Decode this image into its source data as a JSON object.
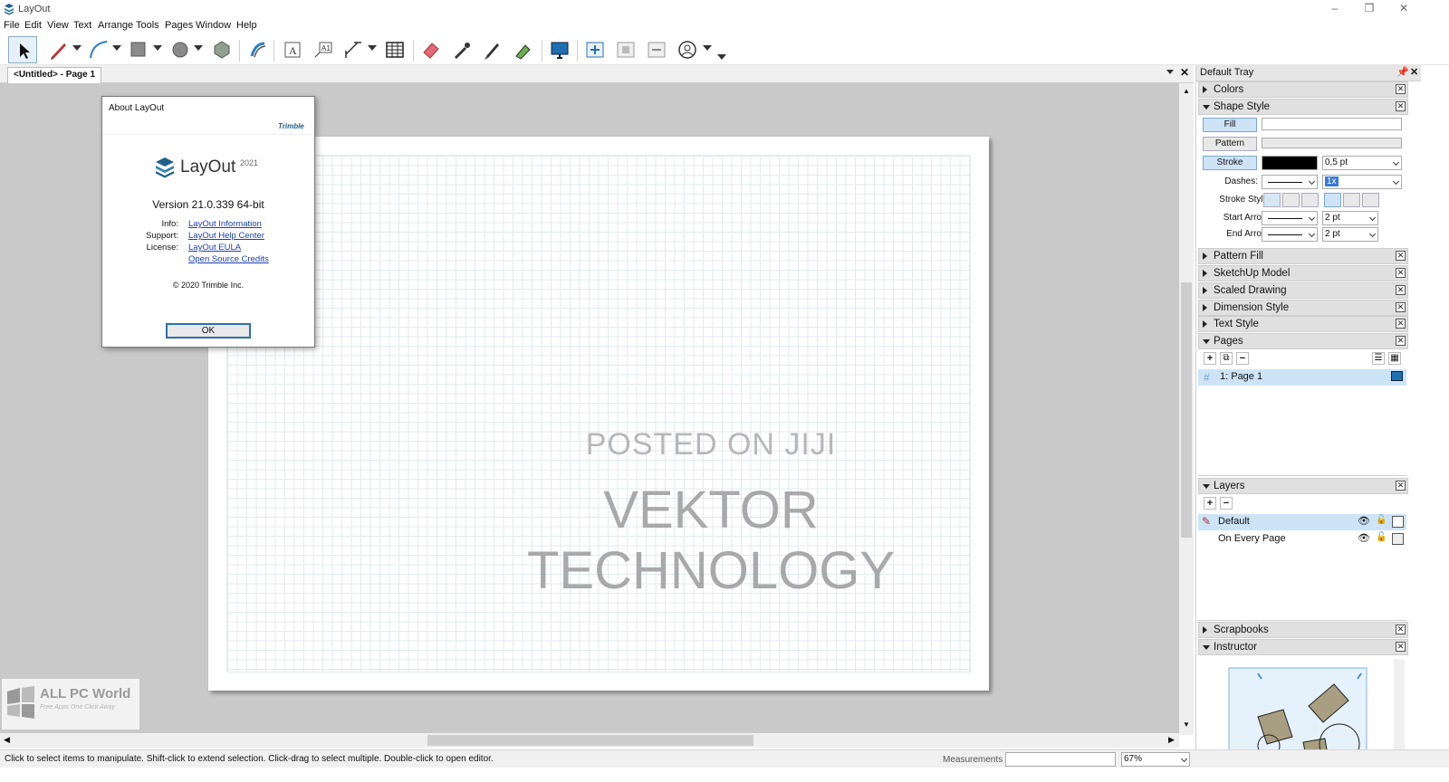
{
  "window": {
    "title": "LayOut",
    "minimize": "–",
    "restore": "❐",
    "close": "✕"
  },
  "menu": [
    "File",
    "Edit",
    "View",
    "Text",
    "Arrange",
    "Tools",
    "Pages",
    "Window",
    "Help"
  ],
  "toolbar": {
    "icons": [
      "select",
      "line",
      "arc",
      "rectangle",
      "circle",
      "polygon",
      "offset",
      "text",
      "label",
      "dimension",
      "table",
      "eraser",
      "style",
      "split",
      "join",
      "presentation",
      "add-page",
      "duplicate-page",
      "delete-page",
      "account"
    ]
  },
  "document": {
    "tab_label": "<Untitled> - Page 1"
  },
  "canvas": {
    "watermark_line1": "POSTED ON JIJI",
    "watermark_line2": "VEKTOR TECHNOLOGY",
    "logo_text": "ALL PC World",
    "logo_sub": "Free Apps One Click Away"
  },
  "about": {
    "title": "About LayOut",
    "brand": "Trimble",
    "product": "LayOut",
    "year": "2021",
    "version": "Version 21.0.339 64-bit",
    "info_label": "Info:",
    "info_link": "LayOut Information",
    "support_label": "Support:",
    "support_link": "LayOut Help Center",
    "license_label": "License:",
    "license_link": "LayOut EULA",
    "credits_link": "Open Source Credits",
    "copyright": "© 2020 Trimble Inc.",
    "ok": "OK"
  },
  "tray": {
    "title": "Default Tray",
    "colors": "Colors",
    "shape_style": {
      "title": "Shape Style",
      "fill": "Fill",
      "pattern": "Pattern",
      "stroke": "Stroke",
      "stroke_width": "0,5 pt",
      "dashes_label": "Dashes:",
      "dash_scale": "1x",
      "stroke_style_label": "Stroke Style:",
      "start_arrow_label": "Start Arrow:",
      "start_arrow_size": "2 pt",
      "end_arrow_label": "End Arrow:",
      "end_arrow_size": "2 pt"
    },
    "pattern_fill": "Pattern Fill",
    "sketchup_model": "SketchUp Model",
    "scaled_drawing": "Scaled Drawing",
    "dimension_style": "Dimension Style",
    "text_style": "Text Style",
    "pages": {
      "title": "Pages",
      "add": "+",
      "dup": "⧉",
      "remove": "−",
      "hash": "#",
      "items": [
        "1:  Page 1"
      ]
    },
    "layers": {
      "title": "Layers",
      "add": "+",
      "remove": "−",
      "items": [
        "Default",
        "On Every Page"
      ]
    },
    "scrapbooks": "Scrapbooks",
    "instructor": "Instructor"
  },
  "status": {
    "hint": "Click to select items to manipulate. Shift-click to extend selection. Click-drag to select multiple. Double-click to open editor.",
    "measurements_label": "Measurements",
    "measurements_value": "",
    "zoom": "67%"
  }
}
